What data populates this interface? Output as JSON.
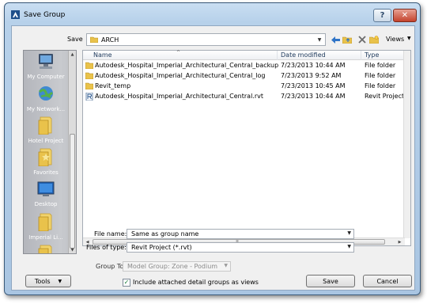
{
  "window": {
    "title": "Save Group"
  },
  "header": {
    "save_label": "Save",
    "current_folder": "ARCH",
    "views_label": "Views"
  },
  "places": [
    {
      "label": "My Computer",
      "icon": "computer-icon"
    },
    {
      "label": "My Network...",
      "icon": "network-icon"
    },
    {
      "label": "Hotel Project",
      "icon": "folder-icon"
    },
    {
      "label": "Favorites",
      "icon": "favorites-folder-icon"
    },
    {
      "label": "Desktop",
      "icon": "desktop-icon"
    },
    {
      "label": "Imperial Li...",
      "icon": "folder-icon"
    }
  ],
  "file_list": {
    "columns": [
      "Name",
      "Date modified",
      "Type"
    ],
    "rows": [
      {
        "name": "Autodesk_Hospital_Imperial_Architectural_Central_backup",
        "date": "7/23/2013 10:44 AM",
        "type": "File folder",
        "icon": "folder-icon"
      },
      {
        "name": "Autodesk_Hospital_Imperial_Architectural_Central_log",
        "date": "7/23/2013 9:52 AM",
        "type": "File folder",
        "icon": "folder-icon"
      },
      {
        "name": "Revit_temp",
        "date": "7/23/2013 10:45 AM",
        "type": "File folder",
        "icon": "folder-icon"
      },
      {
        "name": "Autodesk_Hospital_Imperial_Architectural_Central.rvt",
        "date": "7/23/2013 10:44 AM",
        "type": "Revit Project",
        "icon": "revit-file-icon"
      }
    ]
  },
  "form": {
    "file_name_label": "File name:",
    "file_name_value": "Same as group name",
    "files_of_type_label": "Files of type:",
    "files_of_type_value": "Revit Project  (*.rvt)",
    "group_to_label": "Group To",
    "group_to_value": "Model Group: Zone - Podium",
    "include_detail_label": "Include attached detail groups as views",
    "include_detail_checked": true
  },
  "buttons": {
    "tools": "Tools",
    "save": "Save",
    "cancel": "Cancel"
  },
  "colors": {
    "title_gradient": "#b7d1ea",
    "close_button": "#c4432d",
    "places_bar": "#c8cace"
  }
}
